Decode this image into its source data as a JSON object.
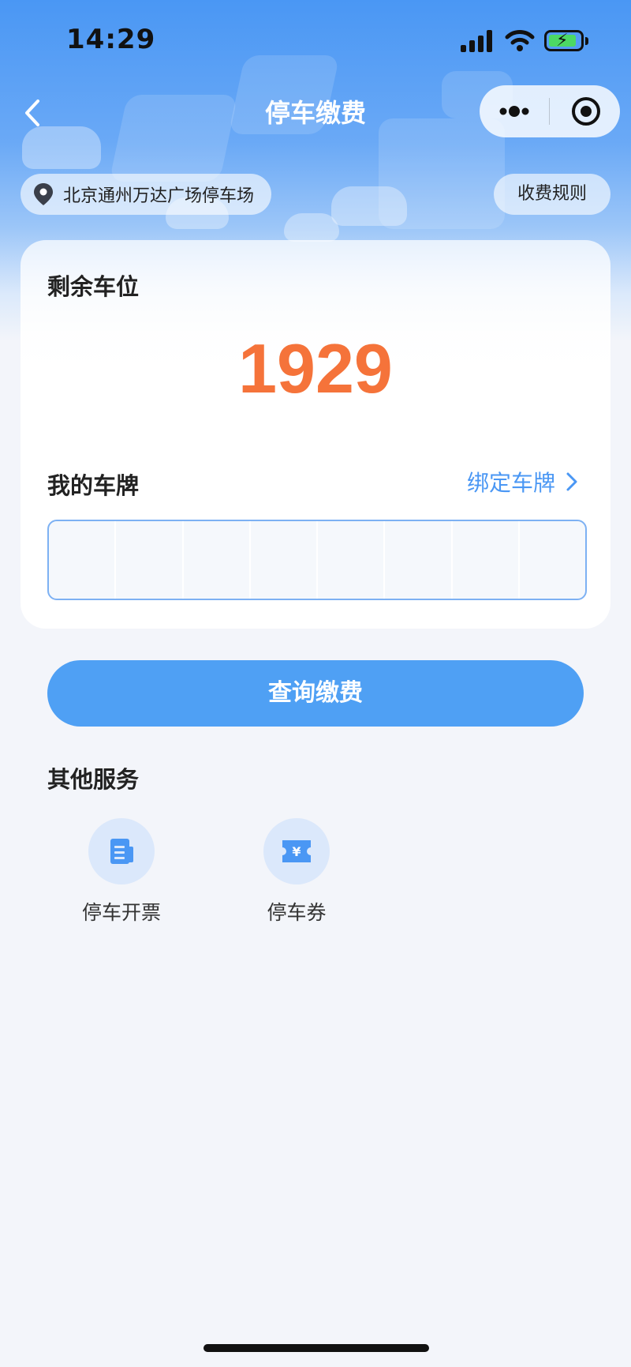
{
  "status_bar": {
    "time": "14:29"
  },
  "nav": {
    "title": "停车缴费"
  },
  "location": {
    "name": "北京通州万达广场停车场",
    "rules_label": "收费规则"
  },
  "spaces": {
    "label": "剩余车位",
    "count": "1929"
  },
  "plate": {
    "label": "我的车牌",
    "bind_label": "绑定车牌",
    "cells": 8
  },
  "actions": {
    "query_label": "查询缴费"
  },
  "services": {
    "title": "其他服务",
    "items": [
      {
        "label": "停车开票",
        "icon": "invoice-icon"
      },
      {
        "label": "停车券",
        "icon": "ticket-icon"
      }
    ]
  },
  "colors": {
    "accent": "#4a97f4",
    "button": "#4fa0f4",
    "count": "#f5733a",
    "battery": "#4cd964"
  }
}
